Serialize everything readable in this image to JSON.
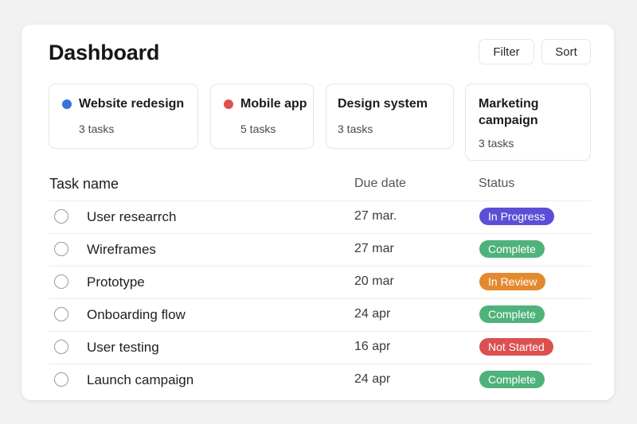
{
  "header": {
    "title": "Dashboard",
    "filter_label": "Filter",
    "sort_label": "Sort"
  },
  "projects": [
    {
      "name": "Website redesign",
      "count": "3 tasks",
      "dot_color": "#3b6fe0"
    },
    {
      "name": "Mobile app",
      "count": "5 tasks",
      "dot_color": "#e05252"
    },
    {
      "name": "Design system",
      "count": "3 tasks"
    },
    {
      "name": "Marketing campaign",
      "count": "3 tasks"
    }
  ],
  "table": {
    "headers": {
      "name": "Task name",
      "due": "Due date",
      "status": "Status"
    },
    "rows": [
      {
        "name": "User researrch",
        "due": "27 mar.",
        "status": "In Progress",
        "status_color": "#5a4fd6"
      },
      {
        "name": "Wireframes",
        "due": "27 mar",
        "status": "Complete",
        "status_color": "#4fb27a"
      },
      {
        "name": "Prototype",
        "due": "20 mar",
        "status": "In Review",
        "status_color": "#e38a2e"
      },
      {
        "name": "Onboarding flow",
        "due": "24 apr",
        "status": "Complete",
        "status_color": "#4fb27a"
      },
      {
        "name": "User testing",
        "due": "16 apr",
        "status": "Not Started",
        "status_color": "#dc5050"
      },
      {
        "name": "Launch campaign",
        "due": "24 apr",
        "status": "Complete",
        "status_color": "#4fb27a"
      }
    ]
  }
}
